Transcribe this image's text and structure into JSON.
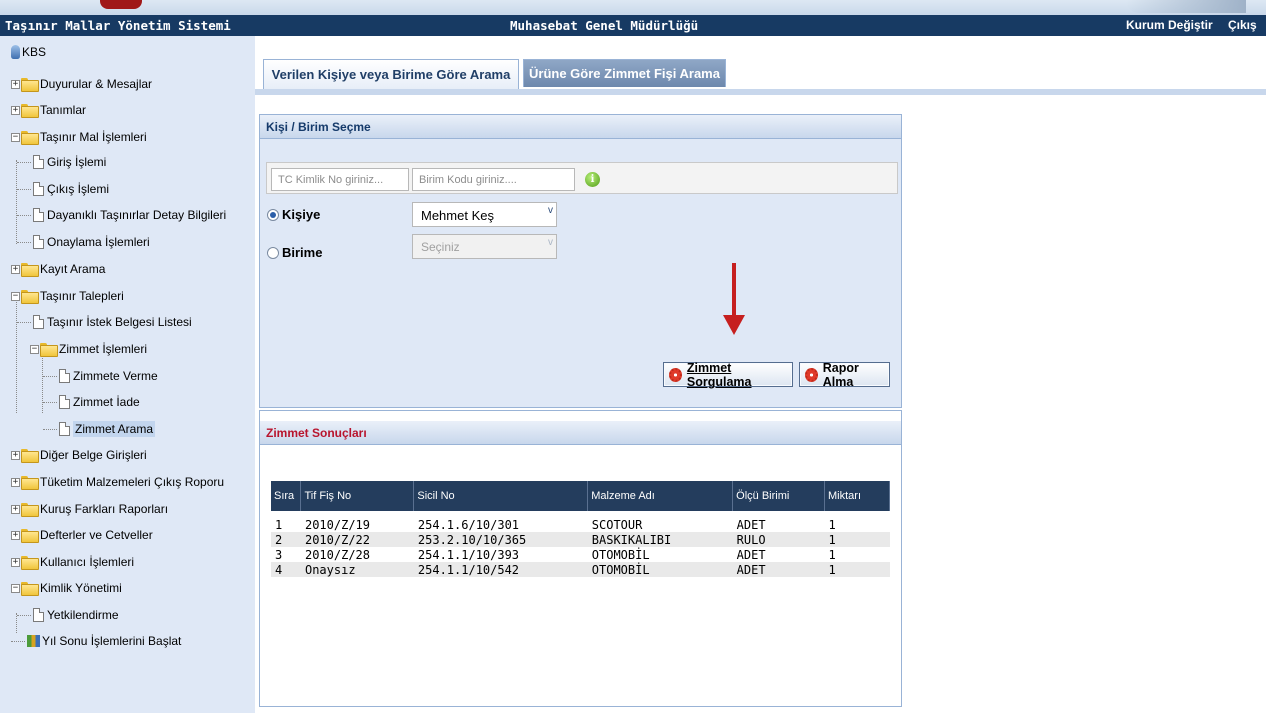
{
  "header": {
    "app_title": "Taşınır Mallar Yönetim Sistemi",
    "org_title": "Muhasebat Genel Müdürlüğü",
    "change_org": "Kurum Değiştir",
    "logout": "Çıkış"
  },
  "sidebar": {
    "root": "KBS",
    "items": [
      "Duyurular & Mesajlar",
      "Tanımlar",
      "Taşınır Mal İşlemleri",
      "Giriş İşlemi",
      "Çıkış İşlemi",
      "Dayanıklı Taşınırlar Detay Bilgileri",
      "Onaylama İşlemleri",
      "Kayıt Arama",
      "Taşınır Talepleri",
      "Taşınır İstek Belgesi Listesi",
      "Zimmet İşlemleri",
      "Zimmete Verme",
      "Zimmet İade",
      "Zimmet Arama",
      "Diğer Belge Girişleri",
      "Tüketim Malzemeleri Çıkış Roporu",
      "Kuruş Farkları Raporları",
      "Defterler ve Cetveller",
      "Kullanıcı İşlemleri",
      "Kimlik Yönetimi",
      "Yetkilendirme",
      "Yıl Sonu İşlemlerini Başlat"
    ],
    "expanders": {
      "plus": "+",
      "minus": "−"
    }
  },
  "tabs": {
    "active": "Verilen Kişiye veya Birime Göre Arama",
    "inactive": "Ürüne Göre Zimmet Fişi Arama"
  },
  "selection_panel": {
    "title": "Kişi / Birim Seçme",
    "tc_placeholder": "TC Kimlik No giriniz...",
    "unit_placeholder": "Birim Kodu giriniz....",
    "info_symbol": "i",
    "person_label": "Kişiye",
    "person_value": "Mehmet Keş",
    "unit_label": "Birime",
    "unit_value": "Seçiniz",
    "dropdown_symbol": "v",
    "query_button": "Zimmet Sorgulama",
    "report_button": "Rapor Alma"
  },
  "results_panel": {
    "title": "Zimmet Sonuçları",
    "columns": [
      "Sıra",
      "Tif Fiş No",
      "Sicil No",
      "Malzeme Adı",
      "Ölçü Birimi",
      "Miktarı"
    ],
    "rows": [
      [
        "1",
        "2010/Z/19",
        "254.1.6/10/301",
        "SCOTOUR",
        "ADET",
        "1"
      ],
      [
        "2",
        "2010/Z/22",
        "253.2.10/10/365",
        "BASKIKALIBI",
        "RULO",
        "1"
      ],
      [
        "3",
        "2010/Z/28",
        "254.1.1/10/393",
        "OTOMOBİL",
        "ADET",
        "1"
      ],
      [
        "4",
        "Onaysız",
        "254.1.1/10/542",
        "OTOMOBİL",
        "ADET",
        "1"
      ]
    ]
  },
  "colors": {
    "titlebar": "#173a63",
    "sidebar": "#dfe8f6",
    "accent_red": "#c61f1f",
    "table_header": "#243d5d"
  }
}
